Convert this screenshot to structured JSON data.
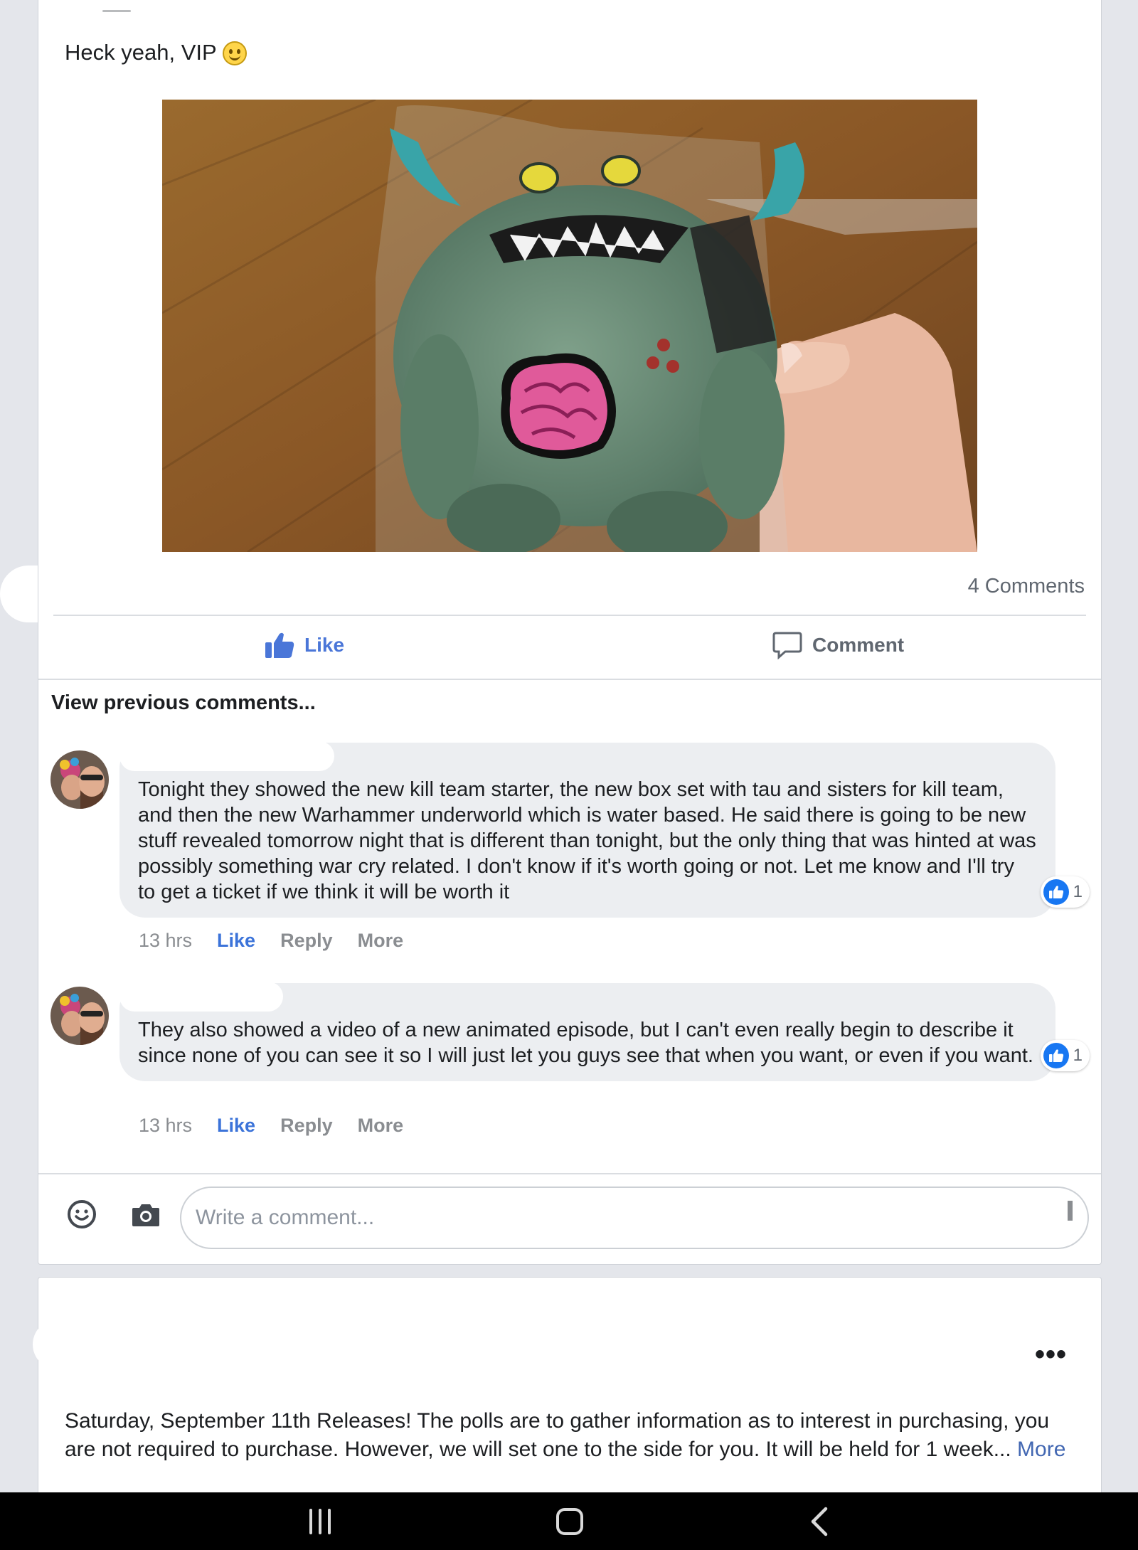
{
  "post1": {
    "text": "Heck yeah, VIP",
    "image_alt": "Green plush monster with blue horns and pink brain patch in plastic bag",
    "comments_count": "4 Comments",
    "actions": {
      "like": "Like",
      "comment": "Comment"
    },
    "view_previous": "View previous comments...",
    "comments": [
      {
        "text": "Tonight they showed the new kill team starter, the new box set with tau and sisters for kill team, and then the new Warhammer underworld which is water based. He said there is going to be new stuff revealed tomorrow night that is different than tonight, but the only thing that was hinted at was possibly something war cry related. I don't know if it's worth going or not. Let me know and I'll try to get a ticket if we think it will be worth it",
        "reactions": "1",
        "time": "13 hrs",
        "like": "Like",
        "reply": "Reply",
        "more": "More"
      },
      {
        "text": "They also showed a video of a new animated episode, but I can't even really begin to describe it since none of you can see it so I will just let you guys see that when you want, or even if you want.",
        "reactions": "1",
        "time": "13 hrs",
        "like": "Like",
        "reply": "Reply",
        "more": "More"
      }
    ],
    "compose": {
      "placeholder": "Write a comment..."
    }
  },
  "post2": {
    "menu": "•••",
    "text": "Saturday, September 11th Releases! The polls are to gather information as to interest in purchasing, you are not required to purchase. However, we will set one to the side for you. It will be held for 1 week...",
    "more": "More"
  },
  "colors": {
    "like_blue": "#4a76d8",
    "reaction_blue": "#1877f2",
    "bubble": "#eceef1"
  }
}
